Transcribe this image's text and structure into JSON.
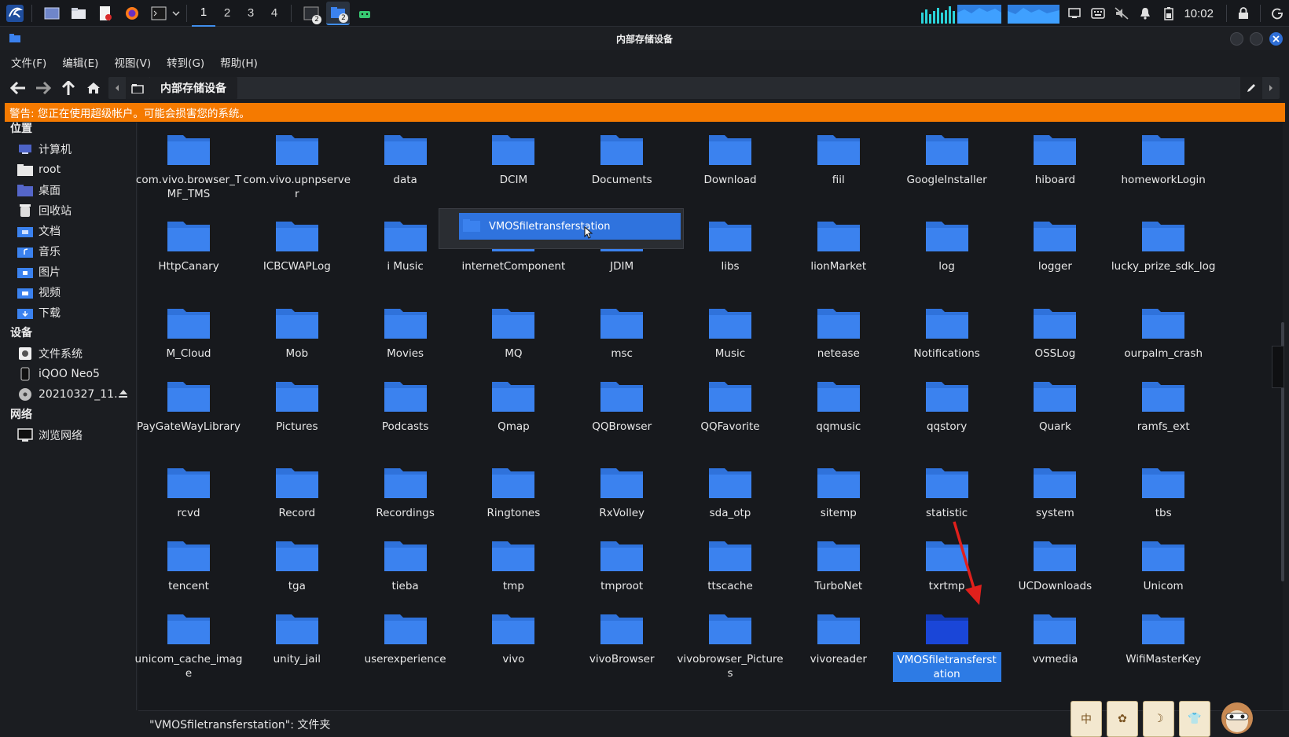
{
  "panel": {
    "workspaces": [
      "1",
      "2",
      "3",
      "4"
    ],
    "badge": "2",
    "clock": "10:02"
  },
  "window": {
    "title": "内部存储设备"
  },
  "menu": [
    "文件(F)",
    "编辑(E)",
    "视图(V)",
    "转到(G)",
    "帮助(H)"
  ],
  "toolbar": {
    "breadcrumb": "内部存储设备"
  },
  "warning": "警告: 您正在使用超级帐户。可能会损害您的系统。",
  "sidebar": {
    "places_title": "位置",
    "places": [
      {
        "label": "计算机",
        "icon": "computer-icon"
      },
      {
        "label": "root",
        "icon": "home-folder-icon"
      },
      {
        "label": "桌面",
        "icon": "desktop-icon"
      },
      {
        "label": "回收站",
        "icon": "trash-icon"
      },
      {
        "label": "文档",
        "icon": "documents-icon"
      },
      {
        "label": "音乐",
        "icon": "music-icon"
      },
      {
        "label": "图片",
        "icon": "pictures-icon"
      },
      {
        "label": "视频",
        "icon": "videos-icon"
      },
      {
        "label": "下载",
        "icon": "downloads-icon"
      }
    ],
    "devices_title": "设备",
    "devices": [
      {
        "label": "文件系统",
        "icon": "filesystem-icon"
      },
      {
        "label": "iQOO Neo5",
        "icon": "phone-icon"
      },
      {
        "label": "20210327_11...",
        "icon": "disc-icon"
      }
    ],
    "network_title": "网络",
    "network": [
      {
        "label": "浏览网络",
        "icon": "network-icon"
      }
    ]
  },
  "files": [
    "com.vivo.browser_TMF_TMS",
    "com.vivo.upnpserver",
    "data",
    "DCIM",
    "Documents",
    "Download",
    "fiil",
    "GoogleInstaller",
    "hiboard",
    "homeworkLogin",
    "HttpCanary",
    "ICBCWAPLog",
    "i Music",
    "internetComponent",
    "JDIM",
    "libs",
    "lionMarket",
    "log",
    "logger",
    "lucky_prize_sdk_log",
    "M_Cloud",
    "Mob",
    "Movies",
    "MQ",
    "msc",
    "Music",
    "netease",
    "Notifications",
    "OSSLog",
    "ourpalm_crash",
    "PayGateWayLibrary",
    "Pictures",
    "Podcasts",
    "Qmap",
    "QQBrowser",
    "QQFavorite",
    "qqmusic",
    "qqstory",
    "Quark",
    "ramfs_ext",
    "rcvd",
    "Record",
    "Recordings",
    "Ringtones",
    "RxVolley",
    "sda_otp",
    "sitemp",
    "statistic",
    "system",
    "tbs",
    "tencent",
    "tga",
    "tieba",
    "tmp",
    "tmproot",
    "ttscache",
    "TurboNet",
    "txrtmp",
    "UCDownloads",
    "Unicom",
    "unicom_cache_image",
    "unity_jail",
    "userexperience",
    "vivo",
    "vivoBrowser",
    "vivobrowser_Pictures",
    "vivoreader",
    "VMOSfiletransferstation",
    "vvmedia",
    "WifiMasterKey"
  ],
  "selected_file": "VMOSfiletransferstation",
  "popup_text": "VMOSfiletransferstation",
  "status": "\"VMOSfiletransferstation\": 文件夹",
  "stickers": [
    "中",
    "✿",
    "☽",
    "👕"
  ],
  "colors": {
    "accent": "#2d7be5",
    "folder": "#3b82ef",
    "warning": "#f57a00",
    "annotation_arrow": "#e0201c"
  }
}
